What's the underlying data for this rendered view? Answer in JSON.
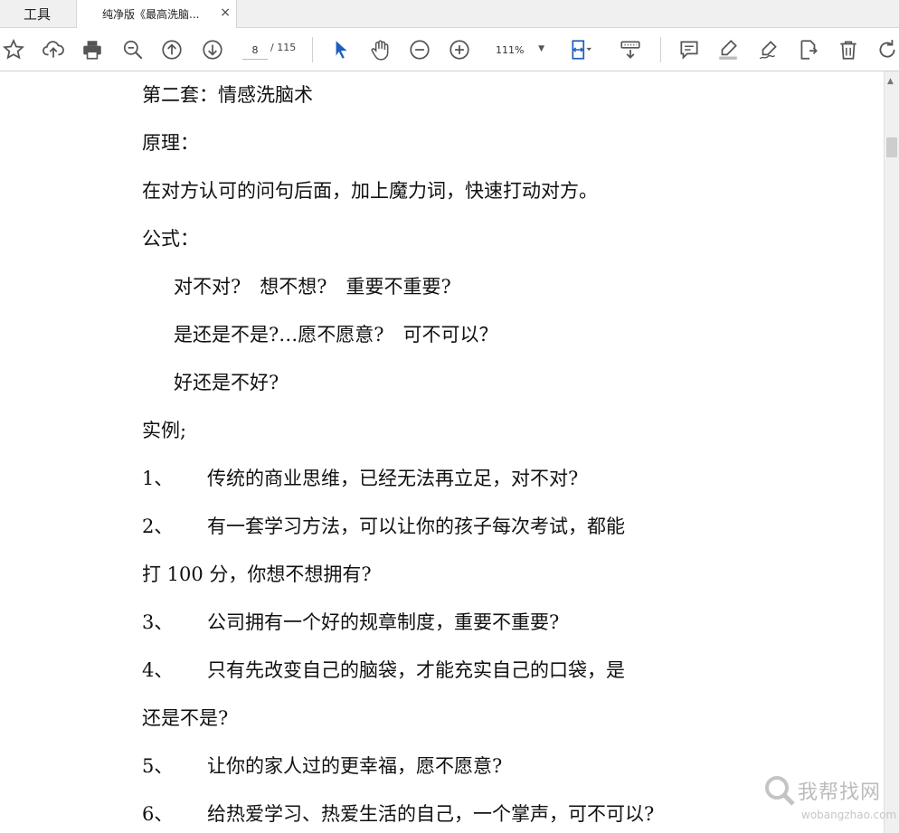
{
  "tabs": {
    "tools_label": "工具",
    "doc_title": "纯净版《最高洗脑...",
    "close_symbol": "×"
  },
  "toolbar": {
    "page_current": "8",
    "page_total": "/ 115",
    "zoom": "111%",
    "accent_color": "#1f5fbf"
  },
  "document": {
    "lines": [
      {
        "text": "第二套：情感洗脑术"
      },
      {
        "text": "原理："
      },
      {
        "text": "在对方认可的问句后面，加上魔力词，快速打动对方。"
      },
      {
        "text": "公式："
      },
      {
        "text": "对不对?　想不想?　重要不重要?"
      },
      {
        "text": "是还是不是?…愿不愿意?　可不可以？"
      },
      {
        "text": "好还是不好?"
      },
      {
        "text": "实例;"
      },
      {
        "num": "1、",
        "text": "传统的商业思维，已经无法再立足，对不对?"
      },
      {
        "num": "2、",
        "text": "有一套学习方法，可以让你的孩子每次考试，都能"
      },
      {
        "text": "打 100 分，你想不想拥有?"
      },
      {
        "num": "3、",
        "text": "公司拥有一个好的规章制度，重要不重要?"
      },
      {
        "num": "4、",
        "text": "只有先改变自己的脑袋，才能充实自己的口袋，是"
      },
      {
        "text": "还是不是?"
      },
      {
        "num": "5、",
        "text": "让你的家人过的更幸福，愿不愿意?"
      },
      {
        "num": "6、",
        "text": "给热爱学习、热爱生活的自己，一个掌声，可不可以?"
      }
    ]
  },
  "watermark": {
    "text": "我帮找网",
    "url": "wobangzhao.com"
  }
}
